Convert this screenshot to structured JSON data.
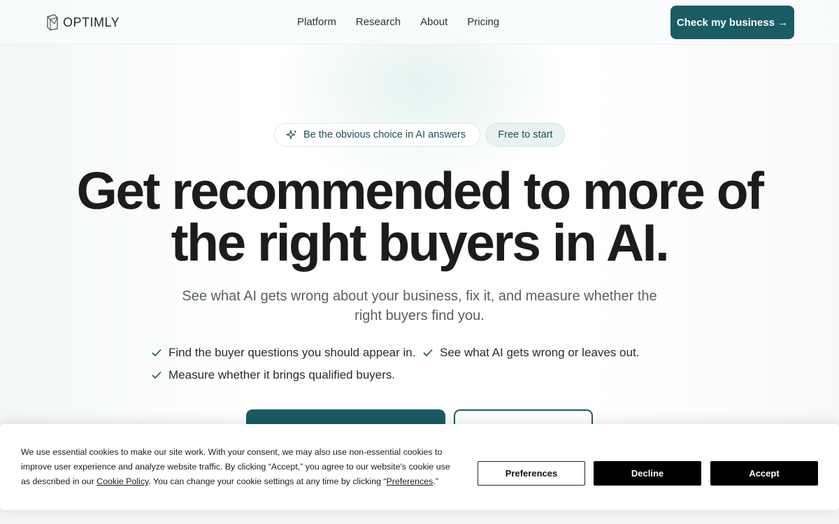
{
  "brand": {
    "name": "OPTIMLY",
    "accent": "#1a5c63"
  },
  "nav": {
    "items": [
      {
        "label": "Platform"
      },
      {
        "label": "Research"
      },
      {
        "label": "About"
      },
      {
        "label": "Pricing"
      }
    ],
    "cta_label": "Check my business →"
  },
  "hero": {
    "pill_primary": {
      "label": "Be the obvious choice in AI answers",
      "icon": "sparkle-icon"
    },
    "pill_secondary": {
      "label": "Free to start"
    },
    "title_line1": "Get recommended to more of",
    "title_line2": "the right buyers in AI.",
    "subtitle_line1": "See what AI gets wrong about your business, fix it, and measure whether the",
    "subtitle_line2": "right buyers find you.",
    "checks": [
      {
        "label": "Find the buyer questions you should appear in."
      },
      {
        "label": "See what AI gets wrong or leaves out."
      },
      {
        "label": "Measure whether it brings qualified buyers."
      }
    ]
  },
  "cookie_banner": {
    "text_part1": "We use essential cookies to make our site work. With your consent, we may also use non-essential cookies to improve user experience and analyze website traffic. By clicking “Accept,” you agree to our website's cookie use as described in our ",
    "policy_link": "Cookie Policy",
    "text_part2": ". You can change your cookie settings at any time by clicking “",
    "pref_link": "Preferences",
    "text_part3": ".”",
    "preferences_label": "Preferences",
    "decline_label": "Decline",
    "accept_label": "Accept"
  }
}
